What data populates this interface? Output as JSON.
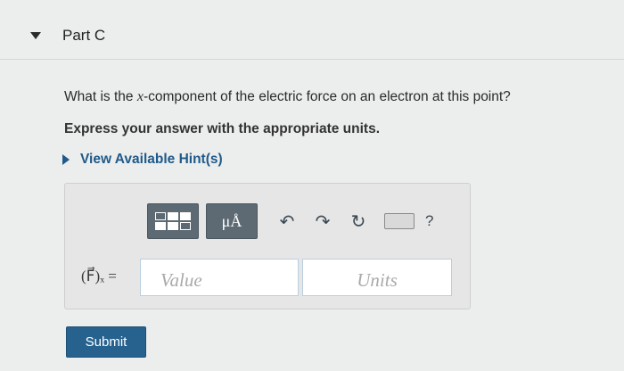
{
  "part": {
    "title": "Part C"
  },
  "question": {
    "text_before": "What is the ",
    "variable": "x",
    "text_after": "-component of the electric force on an electron at this point?",
    "instruction": "Express your answer with the appropriate units."
  },
  "hint": {
    "label": "View Available Hint(s)"
  },
  "toolbar": {
    "units_button": "μÅ",
    "help": "?"
  },
  "answer": {
    "variable_label": "(F⃗)ₓ =",
    "value_placeholder": "Value",
    "units_placeholder": "Units"
  },
  "submit": {
    "label": "Submit"
  },
  "colors": {
    "link": "#1f5a8a",
    "button": "#27628f",
    "toolbar_button": "#5d6a73"
  }
}
